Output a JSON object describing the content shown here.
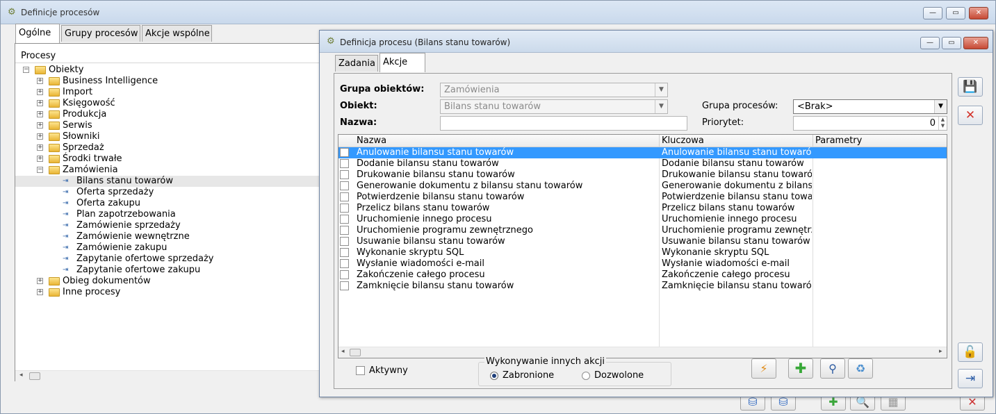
{
  "main_window": {
    "title": "Definicje procesów",
    "tabs": [
      "Ogólne",
      "Grupy procesów",
      "Akcje wspólne"
    ],
    "tree_header": "Procesy",
    "tree": {
      "root": "Obiekty",
      "groups": [
        "Business Intelligence",
        "Import",
        "Księgowość",
        "Produkcja",
        "Serwis",
        "Słowniki",
        "Sprzedaż",
        "Środki trwałe"
      ],
      "open_group": "Zamówienia",
      "processes": [
        "Bilans stanu towarów",
        "Oferta sprzedaży",
        "Oferta zakupu",
        "Plan zapotrzebowania",
        "Zamówienie sprzedaży",
        "Zamówienie wewnętrzne",
        "Zamówienie zakupu",
        "Zapytanie ofertowe sprzedaży",
        "Zapytanie ofertowe zakupu"
      ],
      "bottom_groups": [
        "Obieg dokumentów",
        "Inne procesy"
      ]
    }
  },
  "dialog": {
    "title": "Definicja procesu (Bilans stanu towarów)",
    "tabs": [
      "Zadania",
      "Akcje"
    ],
    "fields": {
      "grupa_label": "Grupa obiektów:",
      "grupa_value": "Zamówienia",
      "obiekt_label": "Obiekt:",
      "obiekt_value": "Bilans stanu towarów",
      "nazwa_label": "Nazwa:",
      "nazwa_value": "",
      "grupa_procesow_label": "Grupa procesów:",
      "grupa_procesow_value": "<Brak>",
      "priorytet_label": "Priorytet:",
      "priorytet_value": "0"
    },
    "grid": {
      "columns": [
        "Nazwa",
        "Kluczowa",
        "Parametry"
      ],
      "rows": [
        {
          "nazwa": "Anulowanie bilansu stanu towarów",
          "kluczowa": "Anulowanie bilansu stanu towarów",
          "parametry": ""
        },
        {
          "nazwa": "Dodanie bilansu stanu towarów",
          "kluczowa": "Dodanie bilansu stanu towarów",
          "parametry": ""
        },
        {
          "nazwa": "Drukowanie bilansu stanu towarów",
          "kluczowa": "Drukowanie bilansu stanu towarów",
          "parametry": ""
        },
        {
          "nazwa": "Generowanie dokumentu z bilansu stanu towarów",
          "kluczowa": "Generowanie dokumentu z bilansu stanu towarów",
          "parametry": ""
        },
        {
          "nazwa": "Potwierdzenie bilansu stanu towarów",
          "kluczowa": "Potwierdzenie bilansu stanu towarów",
          "parametry": ""
        },
        {
          "nazwa": "Przelicz bilans stanu towarów",
          "kluczowa": "Przelicz bilans stanu towarów",
          "parametry": ""
        },
        {
          "nazwa": "Uruchomienie innego procesu",
          "kluczowa": "Uruchomienie innego procesu",
          "parametry": ""
        },
        {
          "nazwa": "Uruchomienie programu zewnętrznego",
          "kluczowa": "Uruchomienie programu zewnętrznego",
          "parametry": ""
        },
        {
          "nazwa": "Usuwanie bilansu stanu towarów",
          "kluczowa": "Usuwanie bilansu stanu towarów",
          "parametry": ""
        },
        {
          "nazwa": "Wykonanie skryptu SQL",
          "kluczowa": "Wykonanie skryptu SQL",
          "parametry": ""
        },
        {
          "nazwa": "Wysłanie wiadomości e-mail",
          "kluczowa": "Wysłanie wiadomości e-mail",
          "parametry": ""
        },
        {
          "nazwa": "Zakończenie całego procesu",
          "kluczowa": "Zakończenie całego procesu",
          "parametry": ""
        },
        {
          "nazwa": "Zamknięcie bilansu stanu towarów",
          "kluczowa": "Zamknięcie bilansu stanu towarów",
          "parametry": ""
        }
      ],
      "selected_row": 0
    },
    "aktywny_label": "Aktywny",
    "aktywny_checked": false,
    "radio_group_title": "Wykonywanie innych akcji",
    "radio_options": [
      "Zabronione",
      "Dozwolone"
    ],
    "radio_selected": "Zabronione",
    "toolbar_icons": [
      "lightning-icon",
      "plus-icon",
      "magnifier-icon",
      "recycle-icon"
    ],
    "side_icons": [
      "save-icon",
      "cancel-icon",
      "unlock-icon",
      "pin-icon"
    ]
  },
  "colors": {
    "selection": "#3399ff",
    "title_gradient": "#c9d9ec",
    "close_red": "#c74a35"
  }
}
